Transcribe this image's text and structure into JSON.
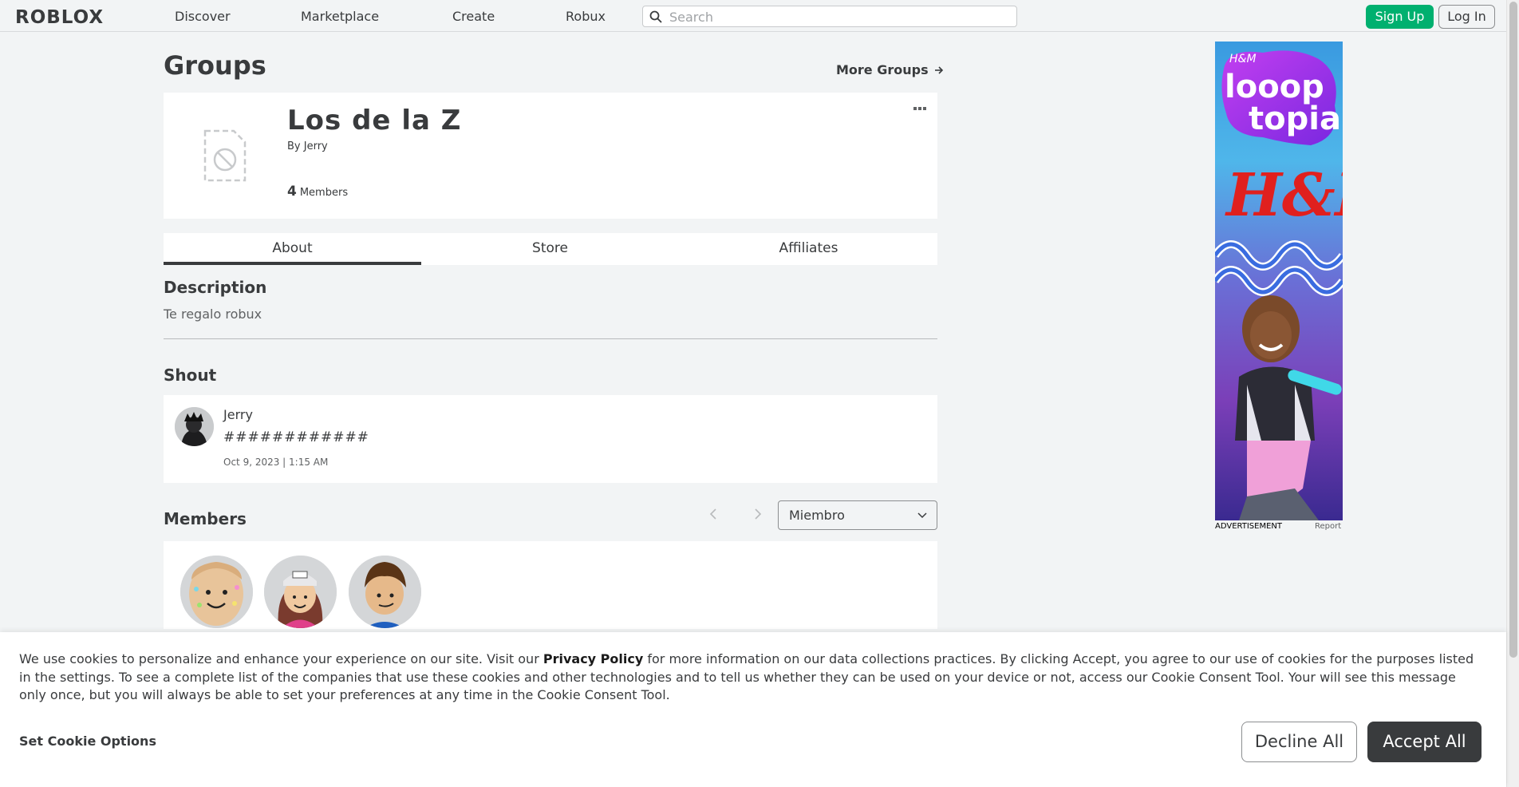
{
  "topbar": {
    "logo": "ROBLOX",
    "nav": [
      "Discover",
      "Marketplace",
      "Create",
      "Robux"
    ],
    "search_placeholder": "Search",
    "signup": "Sign Up",
    "login": "Log In"
  },
  "main": {
    "title": "Groups",
    "more_groups": "More Groups",
    "group": {
      "name": "Los de la Z",
      "by_label": "By",
      "owner": "Jerry",
      "member_count": "4",
      "member_label": "Members"
    },
    "tabs": [
      "About",
      "Store",
      "Affiliates"
    ],
    "active_tab": "About",
    "description": {
      "heading": "Description",
      "text": "Te regalo robux"
    },
    "shout": {
      "heading": "Shout",
      "user": "Jerry",
      "body": "############",
      "time": "Oct 9, 2023 | 1:15 AM"
    },
    "members": {
      "heading": "Members",
      "role_selected": "Miembro"
    }
  },
  "ad": {
    "label": "ADVERTISEMENT",
    "report": "Report",
    "brand_small": "H&M",
    "headline_1": "looop",
    "headline_2": "topia",
    "brand_big": "H&M"
  },
  "cookie": {
    "text_1": "We use cookies to personalize and enhance your experience on our site. Visit our ",
    "privacy_link": "Privacy Policy",
    "text_2": " for more information on our data collections practices. By clicking Accept, you agree to our use of cookies for the purposes listed in the settings. To see a complete list of the companies that use these cookies and other technologies and to tell us whether they can be used on your device or not, access our Cookie Consent Tool. Your will see this message only once, but you will always be able to set your preferences at any time in the Cookie Consent Tool.",
    "options": "Set Cookie Options",
    "decline": "Decline All",
    "accept": "Accept All"
  },
  "colors": {
    "signup_green": "#00b06f",
    "text_dark": "#393b3d",
    "page_bg": "#f2f4f5"
  }
}
